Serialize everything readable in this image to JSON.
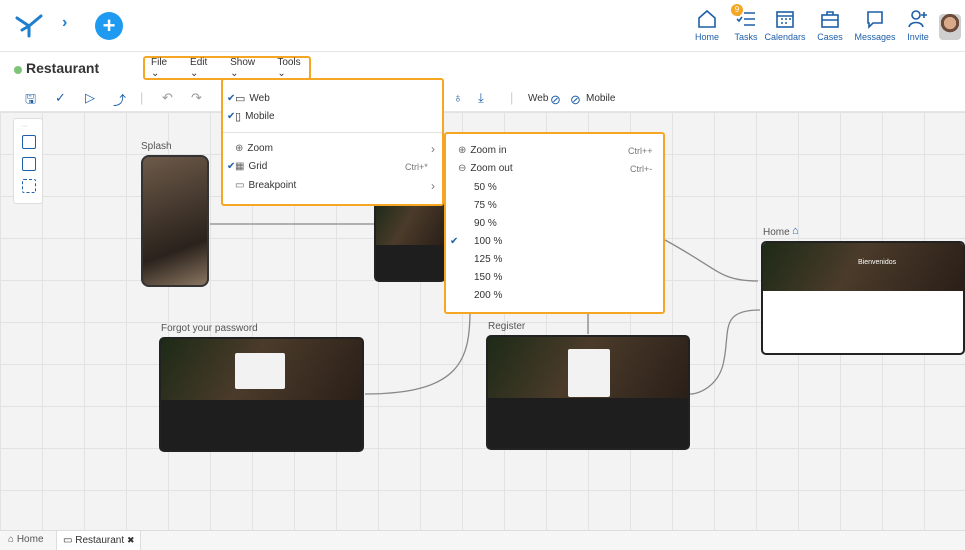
{
  "header": {
    "nav": [
      {
        "label": "Home",
        "icon": "home-icon"
      },
      {
        "label": "Tasks",
        "icon": "tasks-icon",
        "badge": "9"
      },
      {
        "label": "Calendars",
        "icon": "calendar-icon"
      },
      {
        "label": "Cases",
        "icon": "briefcase-icon"
      },
      {
        "label": "Messages",
        "icon": "chat-icon"
      },
      {
        "label": "Invite",
        "icon": "add-user-icon"
      }
    ]
  },
  "app": {
    "name": "Restaurant"
  },
  "menubar": {
    "file": "File ⌄",
    "edit": "Edit ⌄",
    "show": "Show ⌄",
    "tools": "Tools ⌄"
  },
  "toolbar": {
    "web": "Web",
    "mobile": "Mobile"
  },
  "show_menu": {
    "items": [
      {
        "label": "Web",
        "checked": true
      },
      {
        "label": "Mobile",
        "checked": true
      },
      {
        "label": "Zoom",
        "shortcut": "›"
      },
      {
        "label": "Grid",
        "checked": true,
        "shortcut": "Ctrl+*"
      },
      {
        "label": "Breakpoint",
        "shortcut": "›"
      }
    ]
  },
  "zoom_menu": {
    "zoom_in": "Zoom in",
    "zoom_in_shortcut": "Ctrl++",
    "zoom_out": "Zoom out",
    "zoom_out_shortcut": "Ctrl+-",
    "levels": [
      "50 %",
      "75 %",
      "90 %",
      "100 %",
      "125 %",
      "150 %",
      "200 %"
    ],
    "selected": "100 %"
  },
  "canvas": {
    "splash": "Splash",
    "home": "Home",
    "forgot": "Forgot your password",
    "register": "Register",
    "bienvenidos": "Bienvenidos"
  },
  "tabs": {
    "home": "Home",
    "restaurant": "Restaurant",
    "close": "✖"
  }
}
